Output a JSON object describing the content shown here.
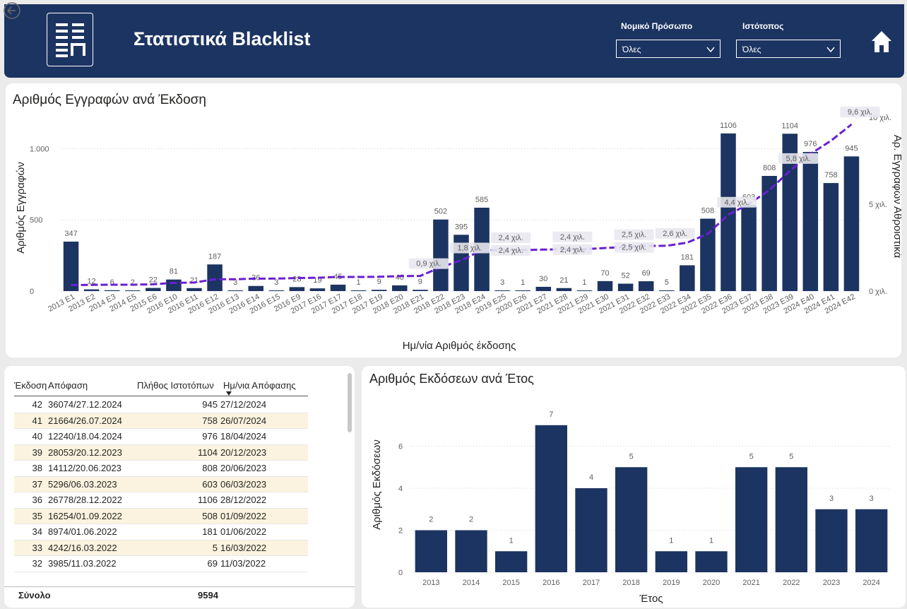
{
  "header": {
    "title": "Στατιστικά Blacklist",
    "filters": [
      {
        "label": "Νομικό Πρόσωπο",
        "value": "Όλες"
      },
      {
        "label": "Ιστότοπος",
        "value": "Όλες"
      }
    ]
  },
  "top_chart": {
    "title": "Αριθμός Εγγραφών ανά Έκδοση",
    "xlabel": "Ημ/νία Αριθμός έκδοσης",
    "ylabel_left": "Αριθμός Εγγραφών",
    "ylabel_right": "Αρ. Εγγραφών Αθροιστικά",
    "left_ticks": [
      "0",
      "500",
      "1.000"
    ],
    "right_ticks": [
      "0 χιλ.",
      "5 χιλ.",
      "10 χιλ."
    ]
  },
  "table": {
    "headers": [
      "Έκδοση",
      "Απόφαση",
      "Πλήθος Ιστοτόπων",
      "Ημ/νια Απόφασης"
    ],
    "rows": [
      [
        "42",
        "36074/27.12.2024",
        "945",
        "27/12/2024"
      ],
      [
        "41",
        "21664/26.07.2024",
        "758",
        "26/07/2024"
      ],
      [
        "40",
        "12240/18.04.2024",
        "976",
        "18/04/2024"
      ],
      [
        "39",
        "28053/20.12.2023",
        "1104",
        "20/12/2023"
      ],
      [
        "38",
        "14112/20.06.2023",
        "808",
        "20/06/2023"
      ],
      [
        "37",
        "5296/06.03.2023",
        "603",
        "06/03/2023"
      ],
      [
        "36",
        "26778/28.12.2022",
        "1106",
        "28/12/2022"
      ],
      [
        "35",
        "16254/01.09.2022",
        "508",
        "01/09/2022"
      ],
      [
        "34",
        "8974/01.06.2022",
        "181",
        "01/06/2022"
      ],
      [
        "33",
        "4242/16.03.2022",
        "5",
        "16/03/2022"
      ],
      [
        "32",
        "3985/11.03.2022",
        "69",
        "11/03/2022"
      ]
    ],
    "total_label": "Σύνολο",
    "total_value": "9594"
  },
  "bottom_chart": {
    "title": "Αριθμός Εκδόσεων ανά Έτος",
    "xlabel": "Έτος",
    "ylabel": "Αριθμός Εκδόσεων",
    "y_ticks": [
      "0",
      "2",
      "4",
      "6"
    ]
  },
  "colors": {
    "bar": "#1c3461",
    "line": "#6a1fd1",
    "header": "#1c3461",
    "row_alt": "#fbf3df"
  },
  "chart_data": [
    {
      "type": "bar",
      "title": "Αριθμός Εγγραφών ανά Έκδοση",
      "categories": [
        "2013 E1",
        "2013 E2",
        "2014 E3",
        "2014 E5",
        "2015 E6",
        "2016 E10",
        "2016 E11",
        "2016 E12",
        "2016 E13",
        "2016 E14",
        "2016 E15",
        "2016 E9",
        "2017 E16",
        "2017 E17",
        "2017 E18",
        "2017 E19",
        "2018 E20",
        "2018 E21",
        "2018 E22",
        "2018 E23",
        "2018 E24",
        "2019 E25",
        "2020 E26",
        "2021 E27",
        "2021 E28",
        "2021 E29",
        "2021 E30",
        "2021 E31",
        "2022 E32",
        "2022 E33",
        "2022 E34",
        "2022 E35",
        "2022 E36",
        "2023 E37",
        "2023 E38",
        "2023 E39",
        "2024 E40",
        "2024 E41",
        "2024 E42"
      ],
      "series": [
        {
          "values": [
            347,
            12,
            6,
            2,
            22,
            81,
            21,
            187,
            3,
            36,
            3,
            28,
            19,
            45,
            1,
            9,
            40,
            9,
            502,
            395,
            585,
            3,
            1,
            30,
            21,
            1,
            70,
            52,
            69,
            5,
            181,
            508,
            1106,
            603,
            808,
            1104,
            976,
            758,
            945
          ]
        },
        {
          "values": [
            347,
            359,
            365,
            367,
            389,
            470,
            491,
            678,
            681,
            717,
            720,
            748,
            767,
            812,
            813,
            822,
            862,
            871,
            1373,
            1768,
            2353,
            2356,
            2357,
            2387,
            2408,
            2409,
            2479,
            2531,
            2600,
            2605,
            2786,
            3294,
            4400,
            5003,
            5811,
            6915,
            7891,
            8649,
            9594
          ]
        }
      ],
      "line_labels": [
        {
          "index": 17,
          "text": "0,9 χιλ."
        },
        {
          "index": 19,
          "text": "1,8 χιλ."
        },
        {
          "index": 21,
          "text": "2,4 χιλ."
        },
        {
          "index": 21,
          "text": "2,4 χιλ."
        },
        {
          "index": 24,
          "text": "2,4 χιλ."
        },
        {
          "index": 24,
          "text": "2,4 χιλ."
        },
        {
          "index": 27,
          "text": "2,5 χιλ."
        },
        {
          "index": 27,
          "text": "2,5 χιλ."
        },
        {
          "index": 29,
          "text": "2,6 χιλ."
        },
        {
          "index": 32,
          "text": "4,4 χιλ."
        },
        {
          "index": 35,
          "text": "5,8 χιλ."
        },
        {
          "index": 38,
          "text": "9,6 χιλ."
        }
      ],
      "ylim": [
        0,
        1150
      ],
      "y2lim": [
        0,
        10000
      ]
    },
    {
      "type": "bar",
      "title": "Αριθμός Εκδόσεων ανά Έτος",
      "categories": [
        "2013",
        "2014",
        "2015",
        "2016",
        "2017",
        "2018",
        "2019",
        "2020",
        "2021",
        "2022",
        "2023",
        "2024"
      ],
      "values": [
        2,
        2,
        1,
        7,
        4,
        5,
        1,
        1,
        5,
        5,
        3,
        3
      ],
      "ylim": [
        0,
        7.8
      ]
    }
  ]
}
